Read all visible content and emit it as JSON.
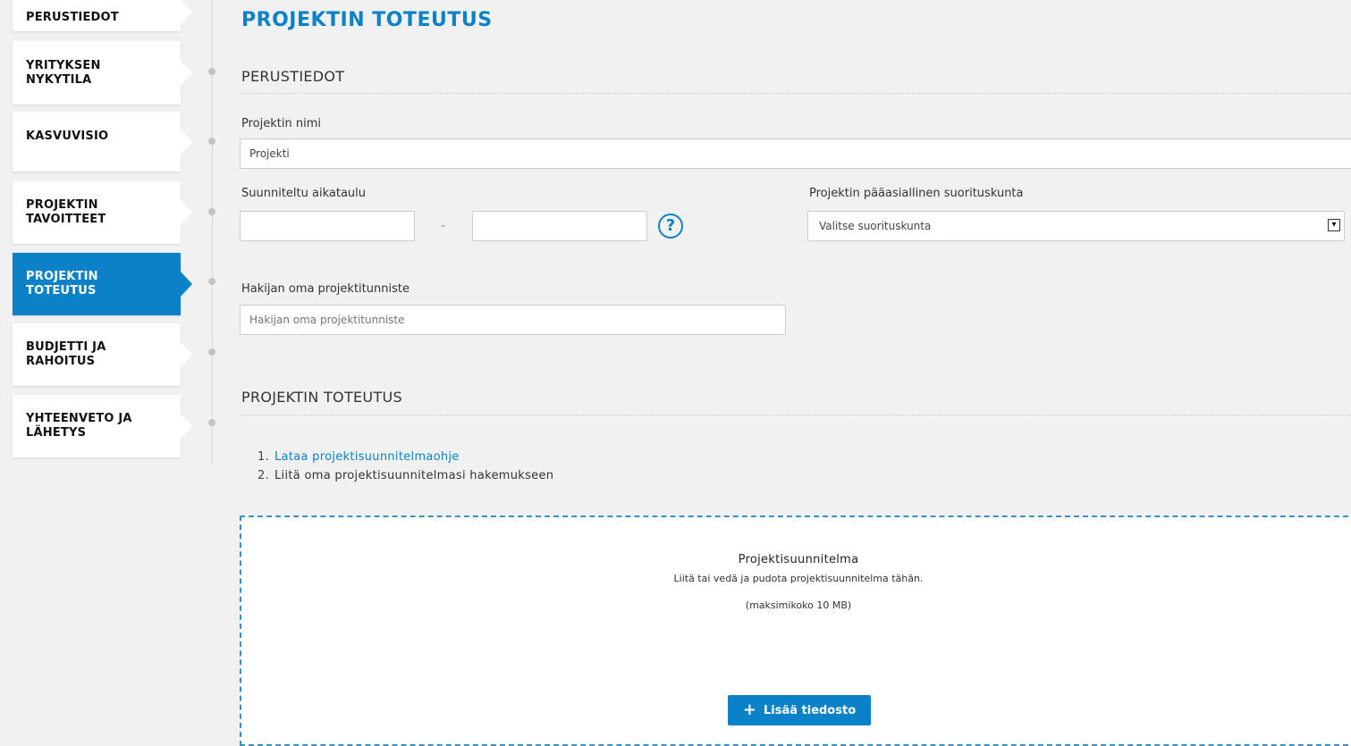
{
  "sidebar": {
    "items": [
      {
        "label": "PERUSTIEDOT"
      },
      {
        "label": "YRITYKSEN\nNYKYTILA"
      },
      {
        "label": "KASVUVISIO"
      },
      {
        "label": "PROJEKTIN\nTAVOITTEET"
      },
      {
        "label": "PROJEKTIN\nTOTEUTUS",
        "active": true
      },
      {
        "label": "BUDJETTI JA\nRAHOITUS"
      },
      {
        "label": "YHTEENVETO JA\nLÄHETYS"
      }
    ]
  },
  "page": {
    "title": "PROJEKTIN TOTEUTUS"
  },
  "basic_section": {
    "title": "PERUSTIEDOT",
    "project_name_label": "Projektin nimi",
    "project_name_value": "Projekti",
    "schedule_label": "Suunniteltu aikataulu",
    "schedule_start_value": "",
    "schedule_separator": "-",
    "schedule_end_value": "",
    "help_icon_glyph": "?",
    "municipality_label": "Projektin pääasiallinen suorituskunta",
    "municipality_selected": "Valitse suorituskunta",
    "chevron_glyph": "▾",
    "applicant_id_label": "Hakijan oma projektitunniste",
    "applicant_id_placeholder": "Hakijan oma projektitunniste"
  },
  "implementation_section": {
    "title": "PROJEKTIN TOTEUTUS",
    "steps": [
      {
        "number": "1.",
        "text": "Lataa projektisuunnitelmaohje",
        "is_link": true
      },
      {
        "number": "2.",
        "text": "Liitä oma projektisuunnitelmasi hakemukseen",
        "is_link": false
      }
    ],
    "dropzone": {
      "title": "Projektisuunnitelma",
      "instruction": "Liitä tai vedä ja pudota projektisuunnitelma tähän.",
      "max_size": "(maksimikoko 10 MB)",
      "button_icon": "+",
      "button_label": "Lisää tiedosto"
    }
  },
  "colors": {
    "accent": "#0b82c8",
    "background": "#f1f1f1"
  }
}
